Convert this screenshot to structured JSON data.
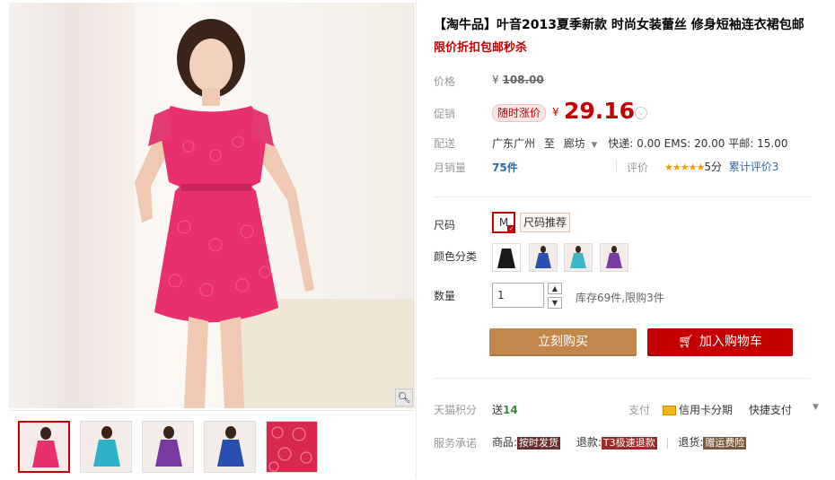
{
  "product": {
    "title": "【淘牛品】叶音2013夏季新款 时尚女装蕾丝 修身短袖连衣裙包邮",
    "subtitle": "限价折扣包邮秒杀"
  },
  "price": {
    "label": "价格",
    "currency": "¥",
    "original": "108.00"
  },
  "promo": {
    "label": "促销",
    "tag": "随时涨价",
    "currency": "¥",
    "price": "29.16"
  },
  "shipping": {
    "label": "配送",
    "from": "广东广州",
    "to_word": "至",
    "destination": "廊坊",
    "fees": "快递: 0.00 EMS: 20.00 平邮: 15.00"
  },
  "sales": {
    "label": "月销量",
    "count": "75件",
    "review_label": "评价",
    "stars": "★★★★★",
    "score": "5分",
    "review_count": "累计评价3"
  },
  "size": {
    "label": "尺码",
    "selected": "M",
    "recommend": "尺码推荐"
  },
  "color": {
    "label": "颜色分类",
    "swatches": [
      {
        "name": "black",
        "color": "#1a1a1a"
      },
      {
        "name": "blue",
        "color": "#2a4fb0"
      },
      {
        "name": "cyan",
        "color": "#3fb6c6"
      },
      {
        "name": "purple",
        "color": "#7a3aa3"
      }
    ]
  },
  "quantity": {
    "label": "数量",
    "value": "1",
    "stock": "库存69件,限购3件"
  },
  "actions": {
    "buy_now": "立刻购买",
    "add_cart": "加入购物车"
  },
  "points": {
    "label": "天猫积分",
    "value_prefix": "送",
    "value": "14",
    "pay_label": "支付",
    "pay_credit": "信用卡分期",
    "pay_quick": "快捷支付"
  },
  "service": {
    "label": "服务承诺",
    "goods_label": "商品:",
    "goods_badge": "按时发货",
    "refund_label": "退款:",
    "refund_badge": "T3极速退款",
    "return_label": "退货:",
    "return_badge": "赠运费险"
  },
  "colors": {
    "accent": "#c40000",
    "buy_button": "#c2884b",
    "dress_pink": "#e8306e"
  },
  "thumbnails": [
    {
      "name": "pink",
      "color": "#e8306e"
    },
    {
      "name": "cyan",
      "color": "#2cb3c8"
    },
    {
      "name": "purple",
      "color": "#7a3aa3"
    },
    {
      "name": "blue",
      "color": "#2a4fb0"
    },
    {
      "name": "lace-detail",
      "color": "#d8284e"
    }
  ]
}
